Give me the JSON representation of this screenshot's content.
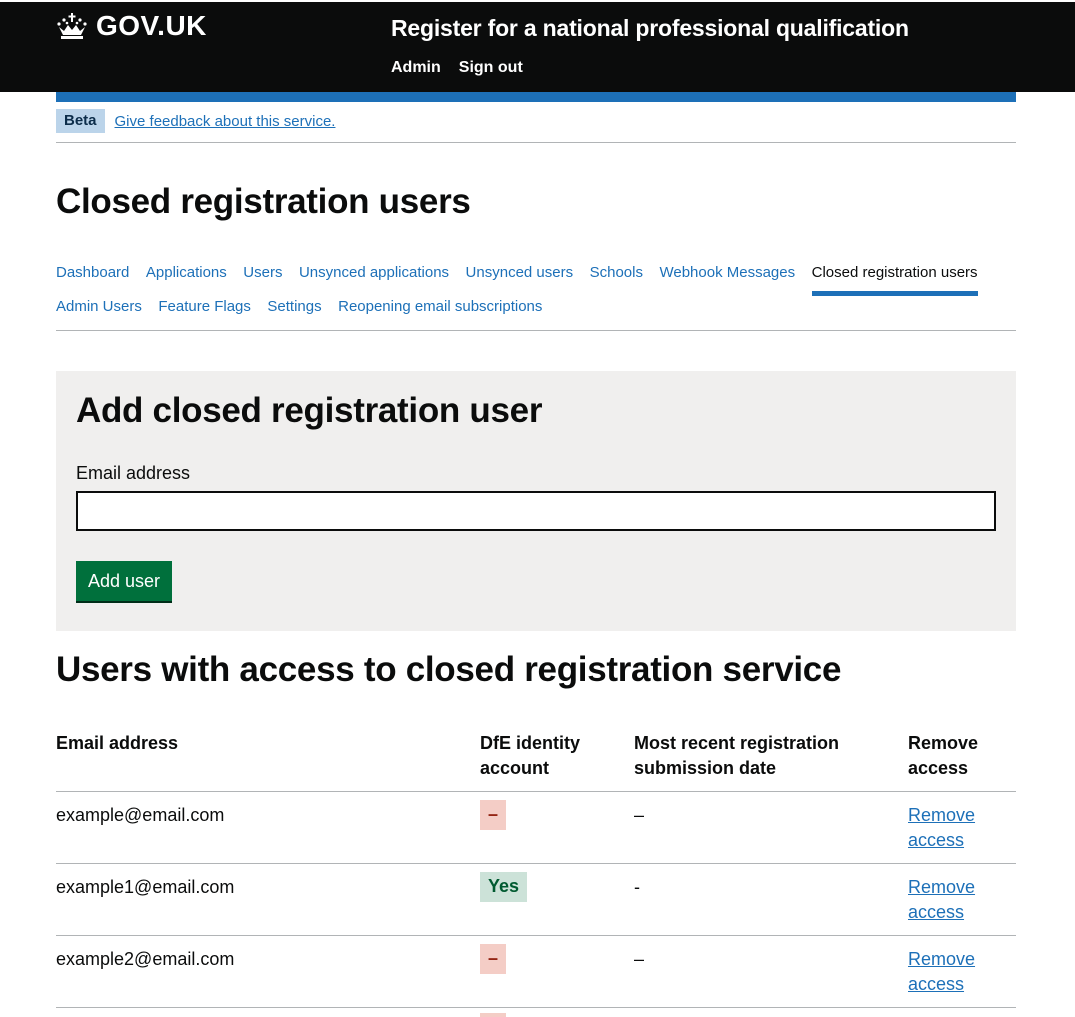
{
  "header": {
    "logo_text": "GOV.UK",
    "logo_icon": "crown-icon",
    "service_name": "Register for a national professional qualification",
    "nav": [
      {
        "label": "Admin"
      },
      {
        "label": "Sign out"
      }
    ]
  },
  "phase_banner": {
    "tag": "Beta",
    "feedback_link": "Give feedback about this service."
  },
  "page": {
    "title": "Closed registration users"
  },
  "subnav": {
    "rows": [
      [
        {
          "label": "Dashboard",
          "active": false
        },
        {
          "label": "Applications",
          "active": false
        },
        {
          "label": "Users",
          "active": false
        },
        {
          "label": "Unsynced applications",
          "active": false
        },
        {
          "label": "Unsynced users",
          "active": false
        },
        {
          "label": "Schools",
          "active": false
        },
        {
          "label": "Webhook Messages",
          "active": false
        },
        {
          "label": "Closed registration users",
          "active": true
        }
      ],
      [
        {
          "label": "Admin Users",
          "active": false
        },
        {
          "label": "Feature Flags",
          "active": false
        },
        {
          "label": "Settings",
          "active": false
        },
        {
          "label": "Reopening email subscriptions",
          "active": false
        }
      ]
    ]
  },
  "add_form": {
    "heading": "Add closed registration user",
    "email_label": "Email address",
    "email_value": "",
    "submit_label": "Add user"
  },
  "users_table": {
    "heading": "Users with access to closed registration service",
    "columns": [
      "Email address",
      "DfE identity account",
      "Most recent registration submission date",
      "Remove access"
    ],
    "rows": [
      {
        "email": "example@email.com",
        "dfe_identity": "–",
        "dfe_status": "no",
        "last_submission": "–",
        "action": "Remove access"
      },
      {
        "email": "example1@email.com",
        "dfe_identity": "Yes",
        "dfe_status": "yes",
        "last_submission": "-",
        "action": "Remove access"
      },
      {
        "email": "example2@email.com",
        "dfe_identity": "–",
        "dfe_status": "no",
        "last_submission": "–",
        "action": "Remove access"
      }
    ]
  },
  "colors": {
    "header_bg": "#0b0c0c",
    "link": "#1d70b8",
    "button": "#00703c",
    "panel_bg": "#f0efee",
    "tag_red_bg": "#f4cdc6",
    "tag_green_bg": "#cce2d8"
  }
}
